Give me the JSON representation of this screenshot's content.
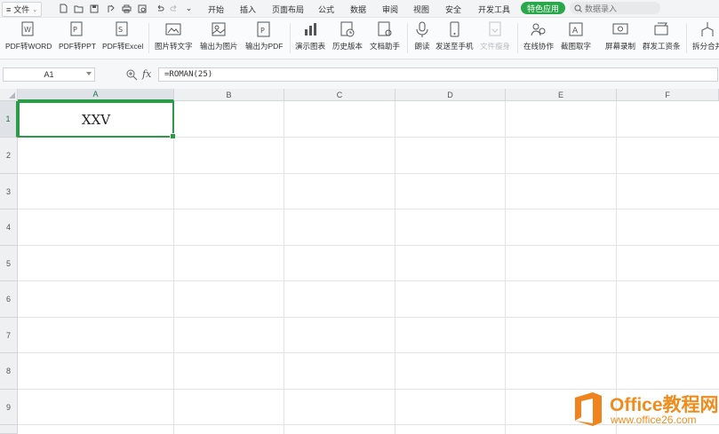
{
  "menubar": {
    "file_label": "文件",
    "tabs": [
      "开始",
      "插入",
      "页面布局",
      "公式",
      "数据",
      "审阅",
      "视图",
      "安全",
      "开发工具"
    ],
    "special_tab": "特色应用",
    "search_placeholder": "数据录入"
  },
  "ribbon": {
    "buttons": [
      "PDF转WORD",
      "PDF转PPT",
      "PDF转Excel",
      "图片转文字",
      "输出为图片",
      "输出为PDF",
      "演示图表",
      "历史版本",
      "文档助手",
      "朗读",
      "发送至手机",
      "文件瘦身",
      "在线协作",
      "截图取字",
      "屏幕录制",
      "群发工资条",
      "拆分合并"
    ]
  },
  "formula_bar": {
    "name_box": "A1",
    "fx_label": "fx",
    "formula": "=ROMAN(25)"
  },
  "grid": {
    "columns": [
      "A",
      "B",
      "C",
      "D",
      "E",
      "F"
    ],
    "rows": [
      "1",
      "2",
      "3",
      "4",
      "5",
      "6",
      "7",
      "8",
      "9"
    ],
    "selected_cell": "A1",
    "cell_a1_value": "XXV"
  },
  "watermark": {
    "title": "Office教程网",
    "url": "www.office26.com"
  },
  "colors": {
    "accent": "#2c9b48",
    "watermark": "#f08c1e"
  }
}
